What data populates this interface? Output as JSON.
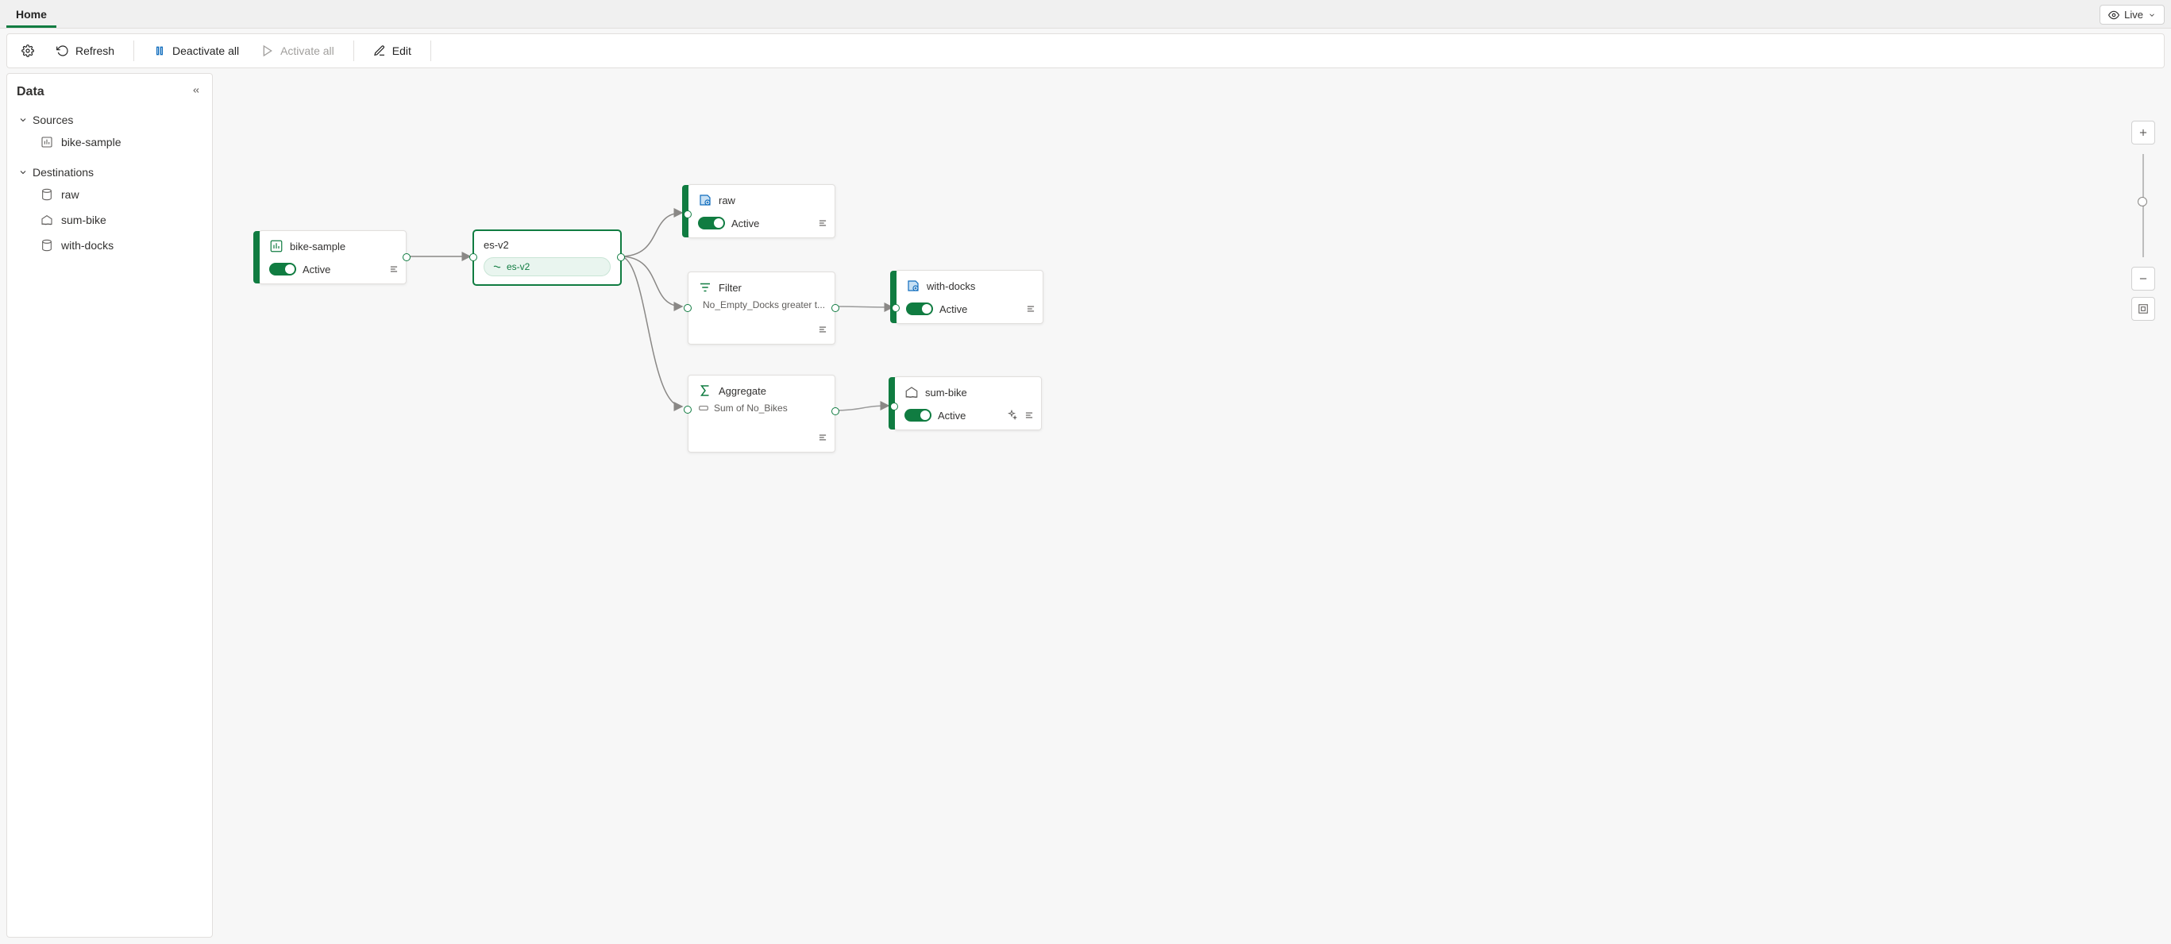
{
  "tabs": {
    "home": "Home"
  },
  "live_button": {
    "label": "Live"
  },
  "toolbar": {
    "refresh": "Refresh",
    "deactivate_all": "Deactivate all",
    "activate_all": "Activate all",
    "edit": "Edit"
  },
  "side": {
    "title": "Data",
    "sources_label": "Sources",
    "destinations_label": "Destinations",
    "sources": [
      {
        "label": "bike-sample",
        "icon": "bar-chart-icon"
      }
    ],
    "destinations": [
      {
        "label": "raw",
        "icon": "database-icon"
      },
      {
        "label": "sum-bike",
        "icon": "lakehouse-icon"
      },
      {
        "label": "with-docks",
        "icon": "database-icon"
      }
    ]
  },
  "nodes": {
    "bike_sample": {
      "title": "bike-sample",
      "status": "Active"
    },
    "es_v2": {
      "title": "es-v2",
      "chip": "es-v2"
    },
    "raw": {
      "title": "raw",
      "status": "Active"
    },
    "filter": {
      "title": "Filter",
      "detail": "No_Empty_Docks greater t..."
    },
    "aggregate": {
      "title": "Aggregate",
      "detail": "Sum of No_Bikes"
    },
    "with_docks": {
      "title": "with-docks",
      "status": "Active"
    },
    "sum_bike": {
      "title": "sum-bike",
      "status": "Active"
    }
  }
}
